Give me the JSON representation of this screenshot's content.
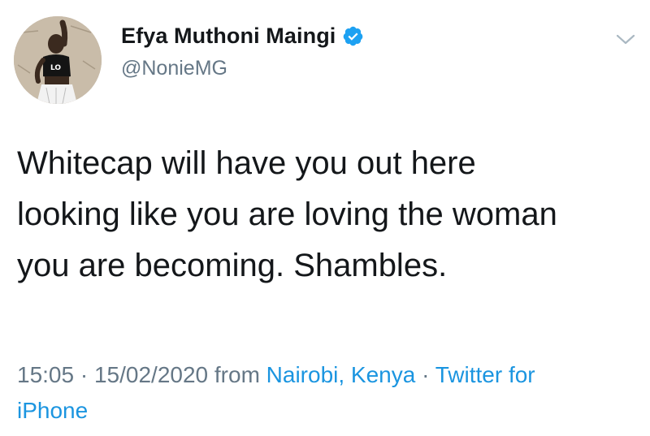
{
  "tweet": {
    "author": {
      "display_name": "Efya Muthoni Maingi",
      "handle": "@NonieMG",
      "verified_icon": "verified-badge-icon",
      "avatar_shirt_text": "LO"
    },
    "menu_icon": "chevron-down-icon",
    "text_lines": [
      "Whitecap will have you out here",
      "looking like you are loving the woman",
      "you are becoming. Shambles."
    ],
    "meta": {
      "time": "15:05",
      "sep1": " · ",
      "date": "15/02/2020",
      "from": " from ",
      "location": "Nairobi, Kenya",
      "sep2": " · ",
      "source_line1": "Twitter for",
      "source_line2": "iPhone"
    },
    "colors": {
      "text": "#14171a",
      "secondary": "#657786",
      "link": "#1b95e0",
      "verified": "#1da1f2"
    }
  }
}
